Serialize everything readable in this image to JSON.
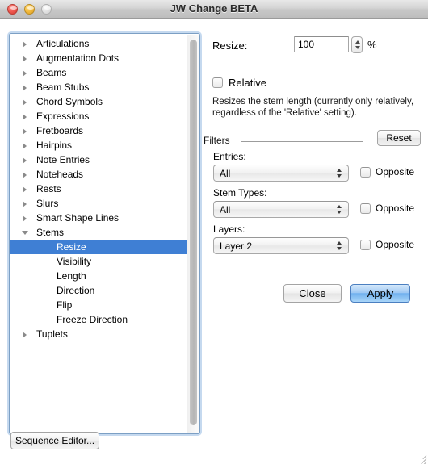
{
  "window": {
    "title": "JW Change BETA",
    "traffic_lights": [
      {
        "name": "close",
        "color": "#f25c54"
      },
      {
        "name": "minimize",
        "color": "#f5bd41"
      },
      {
        "name": "zoom",
        "color": "#e2e2e2"
      }
    ]
  },
  "tree": {
    "items": [
      {
        "label": "Articulations",
        "expandable": true,
        "expanded": false,
        "child": false,
        "selected": false
      },
      {
        "label": "Augmentation Dots",
        "expandable": true,
        "expanded": false,
        "child": false,
        "selected": false
      },
      {
        "label": "Beams",
        "expandable": true,
        "expanded": false,
        "child": false,
        "selected": false
      },
      {
        "label": "Beam Stubs",
        "expandable": true,
        "expanded": false,
        "child": false,
        "selected": false
      },
      {
        "label": "Chord Symbols",
        "expandable": true,
        "expanded": false,
        "child": false,
        "selected": false
      },
      {
        "label": "Expressions",
        "expandable": true,
        "expanded": false,
        "child": false,
        "selected": false
      },
      {
        "label": "Fretboards",
        "expandable": true,
        "expanded": false,
        "child": false,
        "selected": false
      },
      {
        "label": "Hairpins",
        "expandable": true,
        "expanded": false,
        "child": false,
        "selected": false
      },
      {
        "label": "Note Entries",
        "expandable": true,
        "expanded": false,
        "child": false,
        "selected": false
      },
      {
        "label": "Noteheads",
        "expandable": true,
        "expanded": false,
        "child": false,
        "selected": false
      },
      {
        "label": "Rests",
        "expandable": true,
        "expanded": false,
        "child": false,
        "selected": false
      },
      {
        "label": "Slurs",
        "expandable": true,
        "expanded": false,
        "child": false,
        "selected": false
      },
      {
        "label": "Smart Shape Lines",
        "expandable": true,
        "expanded": false,
        "child": false,
        "selected": false
      },
      {
        "label": "Stems",
        "expandable": true,
        "expanded": true,
        "child": false,
        "selected": false
      },
      {
        "label": "Resize",
        "expandable": false,
        "expanded": false,
        "child": true,
        "selected": true
      },
      {
        "label": "Visibility",
        "expandable": false,
        "expanded": false,
        "child": true,
        "selected": false
      },
      {
        "label": "Length",
        "expandable": false,
        "expanded": false,
        "child": true,
        "selected": false
      },
      {
        "label": "Direction",
        "expandable": false,
        "expanded": false,
        "child": true,
        "selected": false
      },
      {
        "label": "Flip",
        "expandable": false,
        "expanded": false,
        "child": true,
        "selected": false
      },
      {
        "label": "Freeze Direction",
        "expandable": false,
        "expanded": false,
        "child": true,
        "selected": false
      },
      {
        "label": "Tuplets",
        "expandable": true,
        "expanded": false,
        "child": false,
        "selected": false
      }
    ],
    "selection_color": "#3f7fd4"
  },
  "panel": {
    "resize_label": "Resize:",
    "resize_value": "100",
    "percent_label": "%",
    "relative_label": "Relative",
    "relative_checked": false,
    "description": "Resizes the stem length (currently only relatively, regardless of the 'Relative' setting)."
  },
  "filters": {
    "title": "Filters",
    "reset_label": "Reset",
    "rows": [
      {
        "caption": "Entries:",
        "value": "All",
        "opposite_label": "Opposite",
        "opposite_checked": false
      },
      {
        "caption": "Stem Types:",
        "value": "All",
        "opposite_label": "Opposite",
        "opposite_checked": false
      },
      {
        "caption": "Layers:",
        "value": "Layer 2",
        "opposite_label": "Opposite",
        "opposite_checked": false
      }
    ]
  },
  "actions": {
    "close_label": "Close",
    "apply_label": "Apply",
    "apply_is_default": true,
    "apply_color": "#6fb0ee"
  },
  "footer": {
    "sequence_editor_label": "Sequence Editor..."
  }
}
